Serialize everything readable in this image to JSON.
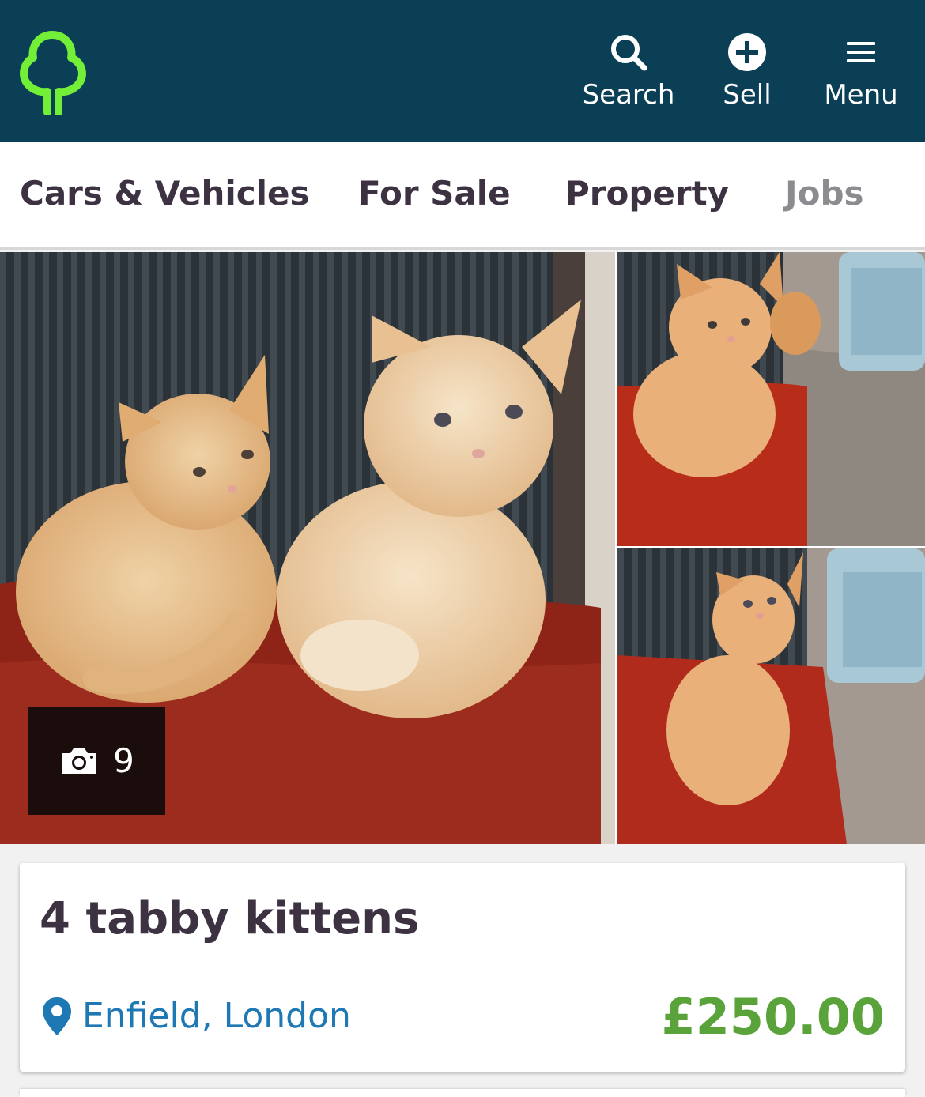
{
  "header": {
    "logo_icon": "tree-logo-icon",
    "buttons": {
      "search": {
        "label": "Search",
        "icon": "search-icon"
      },
      "sell": {
        "label": "Sell",
        "icon": "plus-circle-icon"
      },
      "menu": {
        "label": "Menu",
        "icon": "hamburger-icon"
      }
    }
  },
  "categories": [
    {
      "label": "Cars & Vehicles"
    },
    {
      "label": "For Sale"
    },
    {
      "label": "Property"
    },
    {
      "label": "Jobs"
    }
  ],
  "gallery": {
    "photo_count": "9",
    "count_icon": "camera-icon"
  },
  "listing": {
    "title": "4 tabby kittens",
    "location": "Enfield, London",
    "location_icon": "map-pin-icon",
    "price": "£250.00"
  },
  "colors": {
    "header_bg": "#0b3f56",
    "brand_green": "#72ef36",
    "price_green": "#5aa33b",
    "link_blue": "#1d78b3",
    "text_dark": "#3c3241"
  }
}
